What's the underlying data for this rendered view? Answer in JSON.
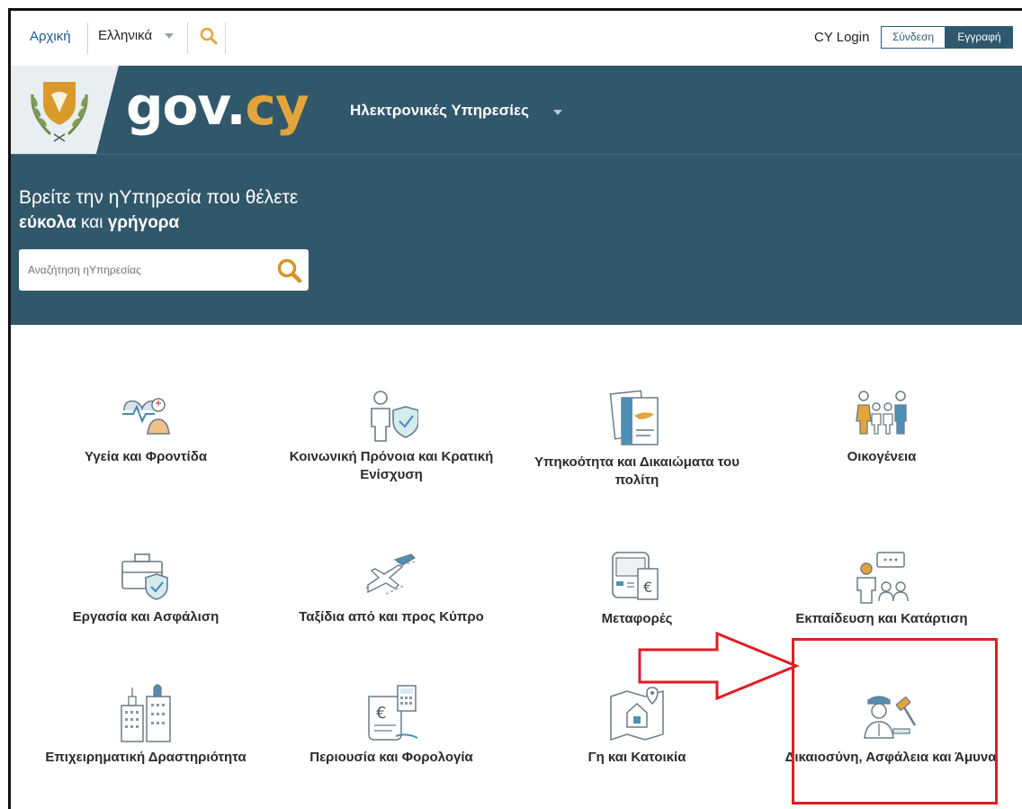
{
  "topbar": {
    "home_label": "Αρχική",
    "language_label": "Ελληνικά",
    "cy_login_label": "CY Login",
    "signin_label": "Σύνδεση",
    "register_label": "Εγγραφή"
  },
  "header": {
    "brand_gov": "gov.",
    "brand_cy": "cy",
    "eservices_label": "Ηλεκτρονικές Υπηρεσίες"
  },
  "hero": {
    "line1": "Βρείτε την ηΥπηρεσία που θέλετε",
    "line2_part1": "εύκολα",
    "line2_part2": " και ",
    "line2_part3": "γρήγορα",
    "search_placeholder": "Αναζήτηση ηΥπηρεσίας"
  },
  "categories": [
    {
      "label": "Υγεία και Φροντίδα",
      "icon": "health-care-icon"
    },
    {
      "label": "Κοινωνική Πρόνοια και Κρατική Ενίσχυση",
      "icon": "social-welfare-icon"
    },
    {
      "label": "Υπηκοότητα και Δικαιώματα του πολίτη",
      "icon": "citizenship-icon"
    },
    {
      "label": "Οικογένεια",
      "icon": "family-icon"
    },
    {
      "label": "Εργασία και Ασφάλιση",
      "icon": "employment-insurance-icon"
    },
    {
      "label": "Ταξίδια από και προς Κύπρο",
      "icon": "travel-icon"
    },
    {
      "label": "Μεταφορές",
      "icon": "transport-icon"
    },
    {
      "label": "Εκπαίδευση και Κατάρτιση",
      "icon": "education-icon"
    },
    {
      "label": "Επιχειρηματική Δραστηριότητα",
      "icon": "business-icon"
    },
    {
      "label": "Περιουσία και Φορολογία",
      "icon": "property-tax-icon"
    },
    {
      "label": "Γη και Κατοικία",
      "icon": "land-housing-icon"
    },
    {
      "label": "Δικαιοσύνη, Ασφάλεια και Άμυνα",
      "icon": "justice-security-icon"
    }
  ],
  "colors": {
    "brand_blue": "#31576b",
    "accent_gold": "#e3a53a",
    "highlight_red": "#e11d25"
  }
}
